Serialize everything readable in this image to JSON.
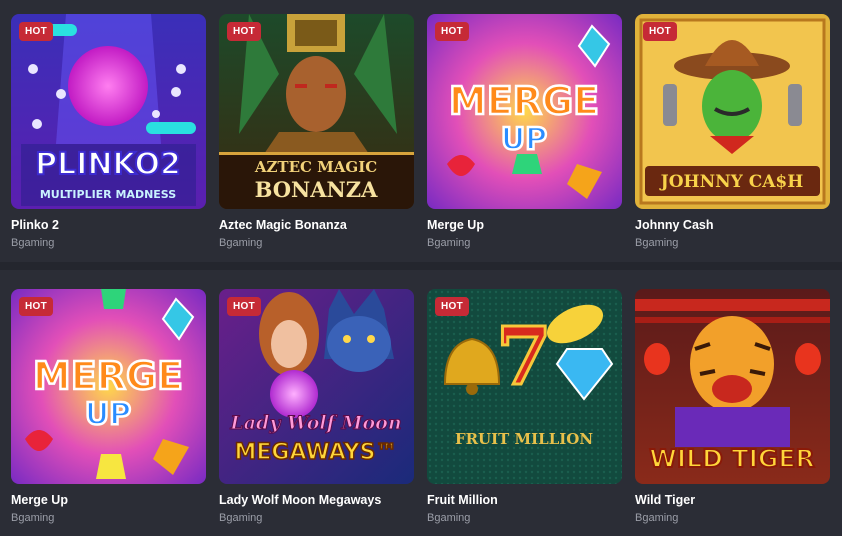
{
  "games": [
    {
      "title": "Plinko 2",
      "provider": "Bgaming",
      "badge": "HOT",
      "art_line1": "PLINKO2",
      "art_line2": "MULTIPLIER MADNESS"
    },
    {
      "title": "Aztec Magic Bonanza",
      "provider": "Bgaming",
      "badge": "HOT",
      "art_line1": "AZTEC MAGIC",
      "art_line2": "BONANZA"
    },
    {
      "title": "Merge Up",
      "provider": "Bgaming",
      "badge": "HOT",
      "art_line1": "MERGE",
      "art_line2": "UP"
    },
    {
      "title": "Johnny Cash",
      "provider": "Bgaming",
      "badge": "HOT",
      "art_line1": "JOHNNY CA$H",
      "art_line2": ""
    },
    {
      "title": "Merge Up",
      "provider": "Bgaming",
      "badge": "HOT",
      "art_line1": "MERGE",
      "art_line2": "UP"
    },
    {
      "title": "Lady Wolf Moon Megaways",
      "provider": "Bgaming",
      "badge": "HOT",
      "art_line1": "Lady Wolf Moon",
      "art_line2": "MEGAWAYS™"
    },
    {
      "title": "Fruit Million",
      "provider": "Bgaming",
      "badge": "HOT",
      "art_line1": "FRUIT MILLION",
      "art_line2": ""
    },
    {
      "title": "Wild Tiger",
      "provider": "Bgaming",
      "badge": "",
      "art_line1": "WILD TIGER",
      "art_line2": ""
    }
  ]
}
